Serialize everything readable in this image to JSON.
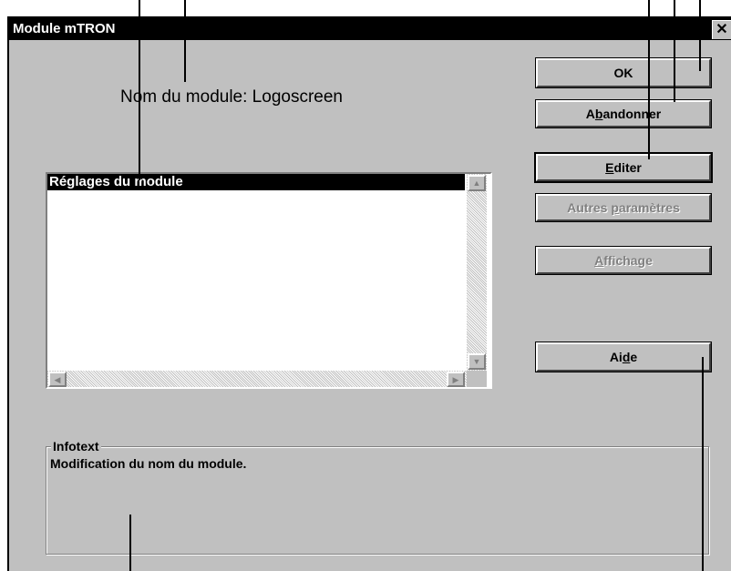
{
  "window": {
    "title": "Module mTRON",
    "close_glyph": "✕"
  },
  "module_name": "Nom du module: Logoscreen",
  "buttons": {
    "ok": "OK",
    "cancel": {
      "pre": "A",
      "u": "b",
      "post": "andonner"
    },
    "edit": {
      "pre": "",
      "u": "E",
      "post": "diter"
    },
    "more_params": {
      "pre": "Autres ",
      "u": "p",
      "post": "aramètres"
    },
    "display": {
      "pre": "",
      "u": "A",
      "post": "ffichage"
    },
    "help": {
      "pre": "Ai",
      "u": "d",
      "post": "e"
    }
  },
  "listbox": {
    "selected_item": "Réglages du module"
  },
  "infotext": {
    "legend": "Infotext",
    "text": "Modification du nom du module."
  },
  "icons": {
    "scroll_up": "▲",
    "scroll_down": "▼",
    "scroll_left": "◀",
    "scroll_right": "▶"
  }
}
